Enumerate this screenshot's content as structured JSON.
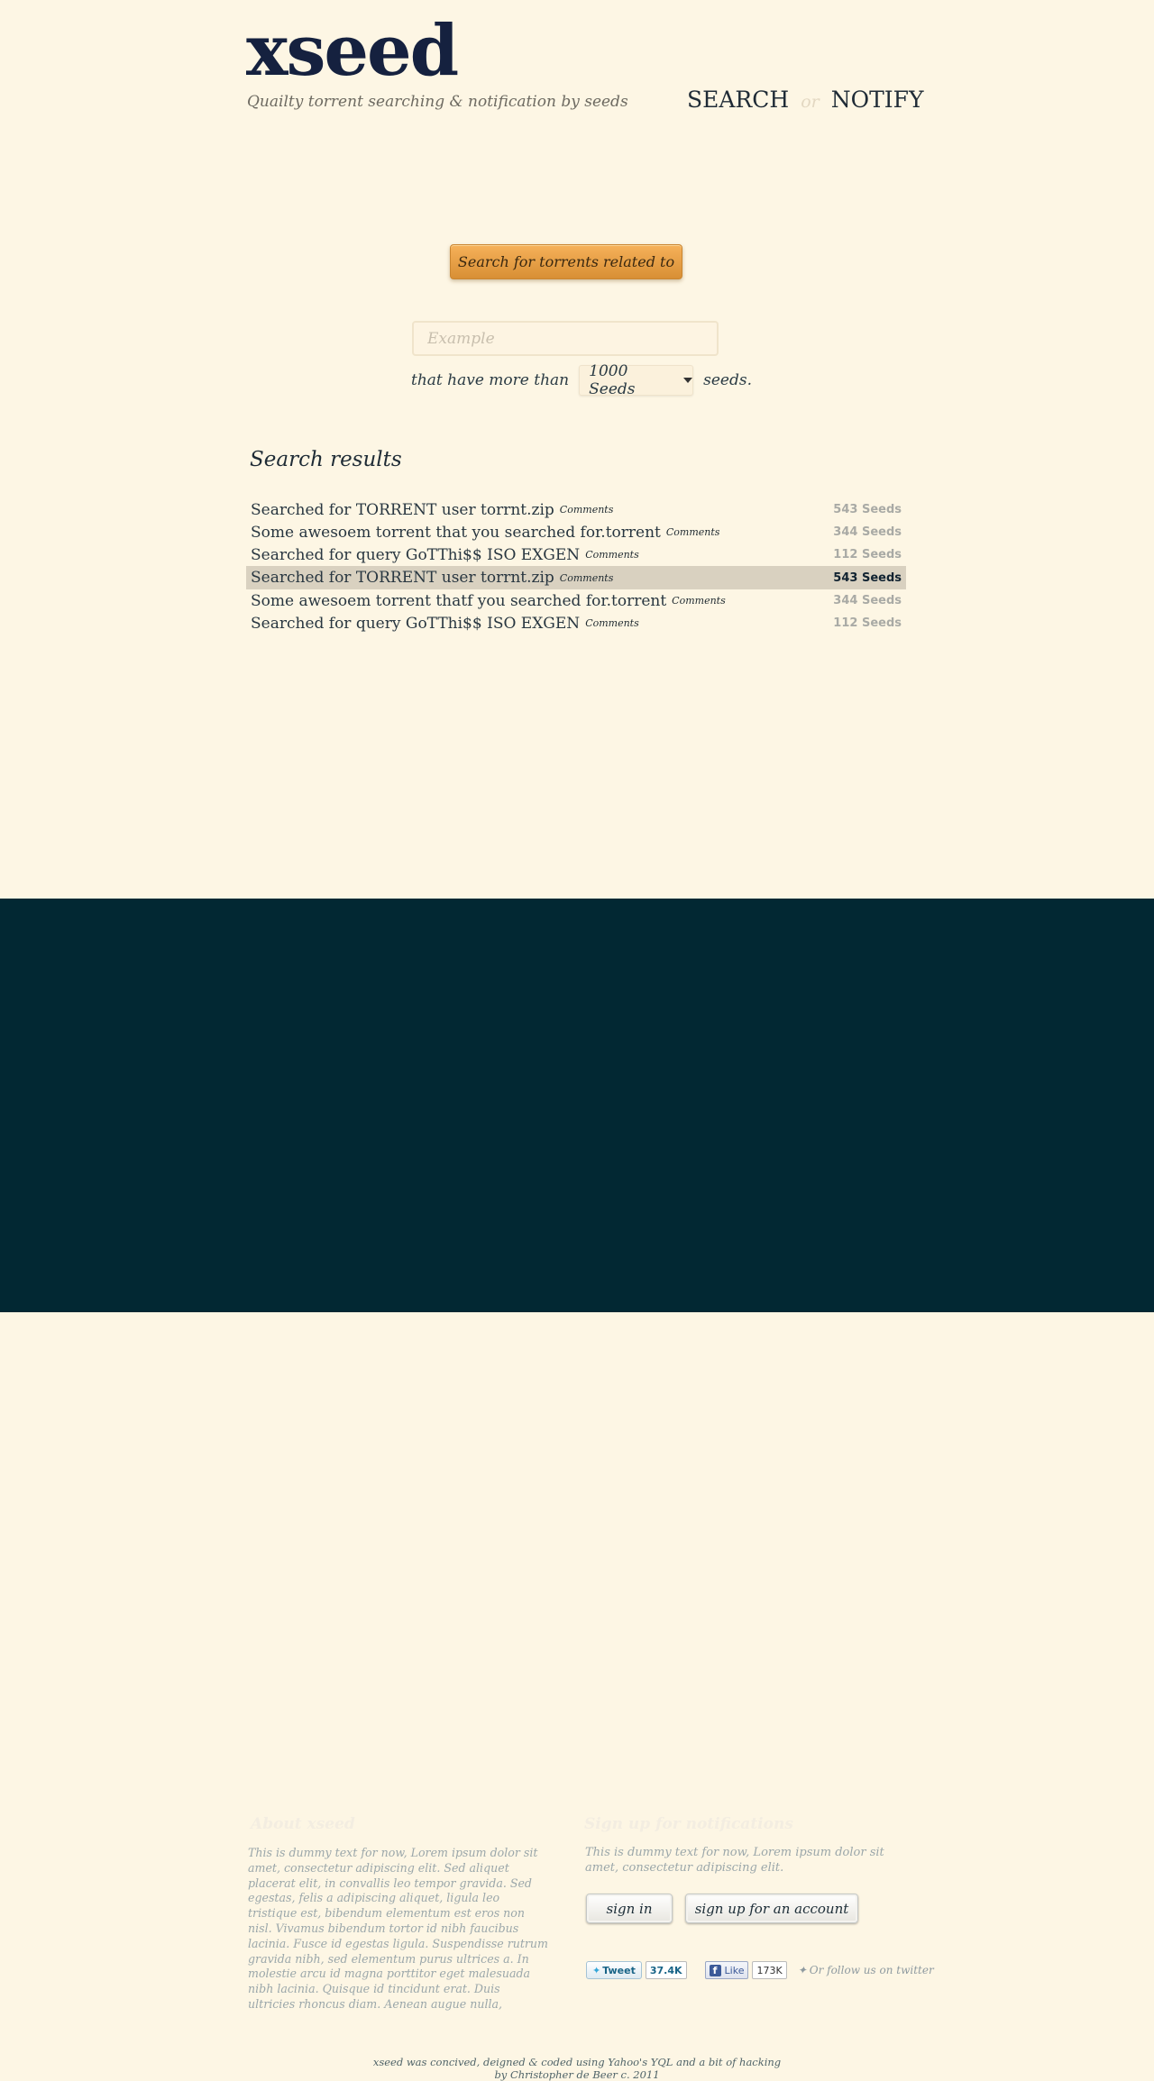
{
  "header": {
    "logo": "xseed",
    "tagline": "Quailty torrent searching & notification by seeds",
    "nav": {
      "search": "SEARCH",
      "or": "or",
      "notify": "NOTIFY"
    }
  },
  "search": {
    "button_label": "Search for torrents related to",
    "placeholder": "Example",
    "value": "",
    "filter_prefix": "that have more than",
    "seed_option": "1000 Seeds",
    "filter_suffix": "seeds."
  },
  "results": {
    "title": "Search results",
    "comments_label": "Comments",
    "items": [
      {
        "name": "Searched for TORRENT user torrnt.zip",
        "comments": "Comments",
        "seeds": "543 Seeds",
        "highlighted": false
      },
      {
        "name": "Some awesoem torrent that you searched for.torrent",
        "comments": "Comments",
        "seeds": "344 Seeds",
        "highlighted": false
      },
      {
        "name": "Searched for query GoTThi$$ ISO EXGEN",
        "comments": "Comments",
        "seeds": "112 Seeds",
        "highlighted": false
      },
      {
        "name": "Searched for TORRENT user torrnt.zip",
        "comments": "Comments",
        "seeds": "543 Seeds",
        "highlighted": true
      },
      {
        "name": "Some awesoem torrent thatf you searched for.torrent",
        "comments": "Comments",
        "seeds": "344 Seeds",
        "highlighted": false
      },
      {
        "name": "Searched for query GoTThi$$ ISO EXGEN",
        "comments": "Comments",
        "seeds": "112 Seeds",
        "highlighted": false
      }
    ]
  },
  "footer": {
    "about_title": "About xseed",
    "about_text": "This is dummy text for now, Lorem ipsum dolor sit amet, consectetur adipiscing elit. Sed aliquet placerat elit, in convallis leo tempor gravida. Sed egestas, felis a adipiscing aliquet, ligula leo tristique est, bibendum elementum est eros non nisl. Vivamus bibendum tortor id nibh faucibus lacinia. Fusce id egestas ligula. Suspendisse rutrum gravida nibh, sed elementum purus ultrices a. In molestie arcu id magna porttitor eget malesuada nibh lacinia. Quisque id tincidunt erat. Duis ultricies rhoncus diam. Aenean augue nulla,",
    "signup_title": "Sign up for notifications",
    "signup_text": "This is dummy text for now, Lorem ipsum dolor sit amet, consectetur adipiscing elit.",
    "sign_in": "sign in",
    "sign_up": "sign up for an account",
    "tweet_label": "Tweet",
    "tweet_count": "37.4K",
    "like_label": "Like",
    "like_count": "173K",
    "follow_text": "Or follow us on twitter",
    "credit_line1": "xseed was concived, deigned & coded using Yahoo's YQL and a bit of hacking",
    "credit_line2": "by Christopher de Beer c. 2011"
  }
}
